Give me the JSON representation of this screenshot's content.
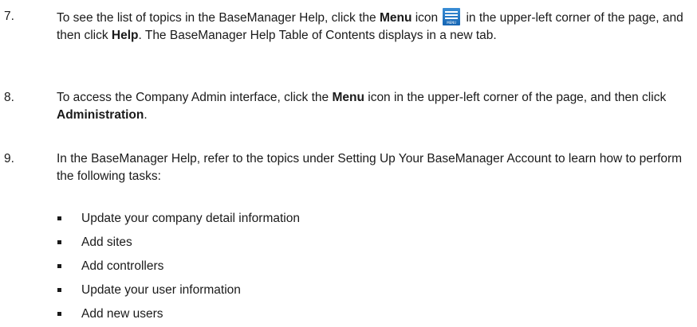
{
  "steps": [
    {
      "number": "7.",
      "text_before_menu": "To see the list of topics in the BaseManager Help, click the ",
      "menu_bold": "Menu",
      "text_icon": " icon",
      "menu_icon_label": "MENU",
      "text_after_icon": " in the upper-left corner of the page, and then click ",
      "help_bold": "Help",
      "text_end": ". The BaseManager Help Table of Contents displays in a new tab."
    },
    {
      "number": "8.",
      "text_before_menu": "To access the Company Admin interface, click the ",
      "menu_bold": "Menu",
      "text_after_menu": " icon in the upper-left corner of the page, and then click ",
      "admin_bold": "Administration",
      "text_end": "."
    },
    {
      "number": "9.",
      "text": "In the BaseManager Help, refer to the topics under Setting Up Your BaseManager Account to learn how to perform the following tasks:"
    }
  ],
  "tasks": [
    "Update your company detail information",
    "Add sites",
    "Add controllers",
    "Update your user information",
    "Add new users"
  ]
}
